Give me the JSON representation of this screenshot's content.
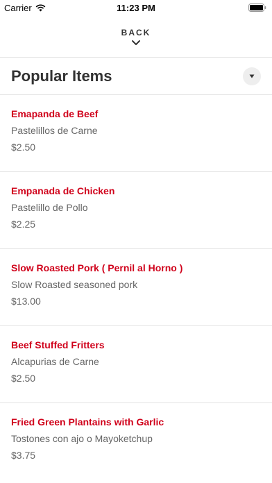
{
  "status_bar": {
    "carrier": "Carrier",
    "time": "11:23 PM"
  },
  "nav": {
    "back_label": "BACK"
  },
  "section": {
    "title": "Popular Items"
  },
  "items": [
    {
      "name": "Emapanda de Beef",
      "description": "Pastelillos de Carne",
      "price": "$2.50"
    },
    {
      "name": "Empanada de Chicken",
      "description": "Pastelillo de Pollo",
      "price": "$2.25"
    },
    {
      "name": "Slow Roasted Pork ( Pernil al Horno )",
      "description": "Slow Roasted seasoned pork",
      "price": "$13.00"
    },
    {
      "name": "Beef Stuffed Fritters",
      "description": "Alcapurias de Carne",
      "price": "$2.50"
    },
    {
      "name": "Fried Green Plantains with Garlic",
      "description": "Tostones con ajo o Mayoketchup",
      "price": "$3.75"
    }
  ],
  "colors": {
    "item_name": "#d0021b",
    "text_secondary": "#666666",
    "divider": "#e3e3e3"
  }
}
